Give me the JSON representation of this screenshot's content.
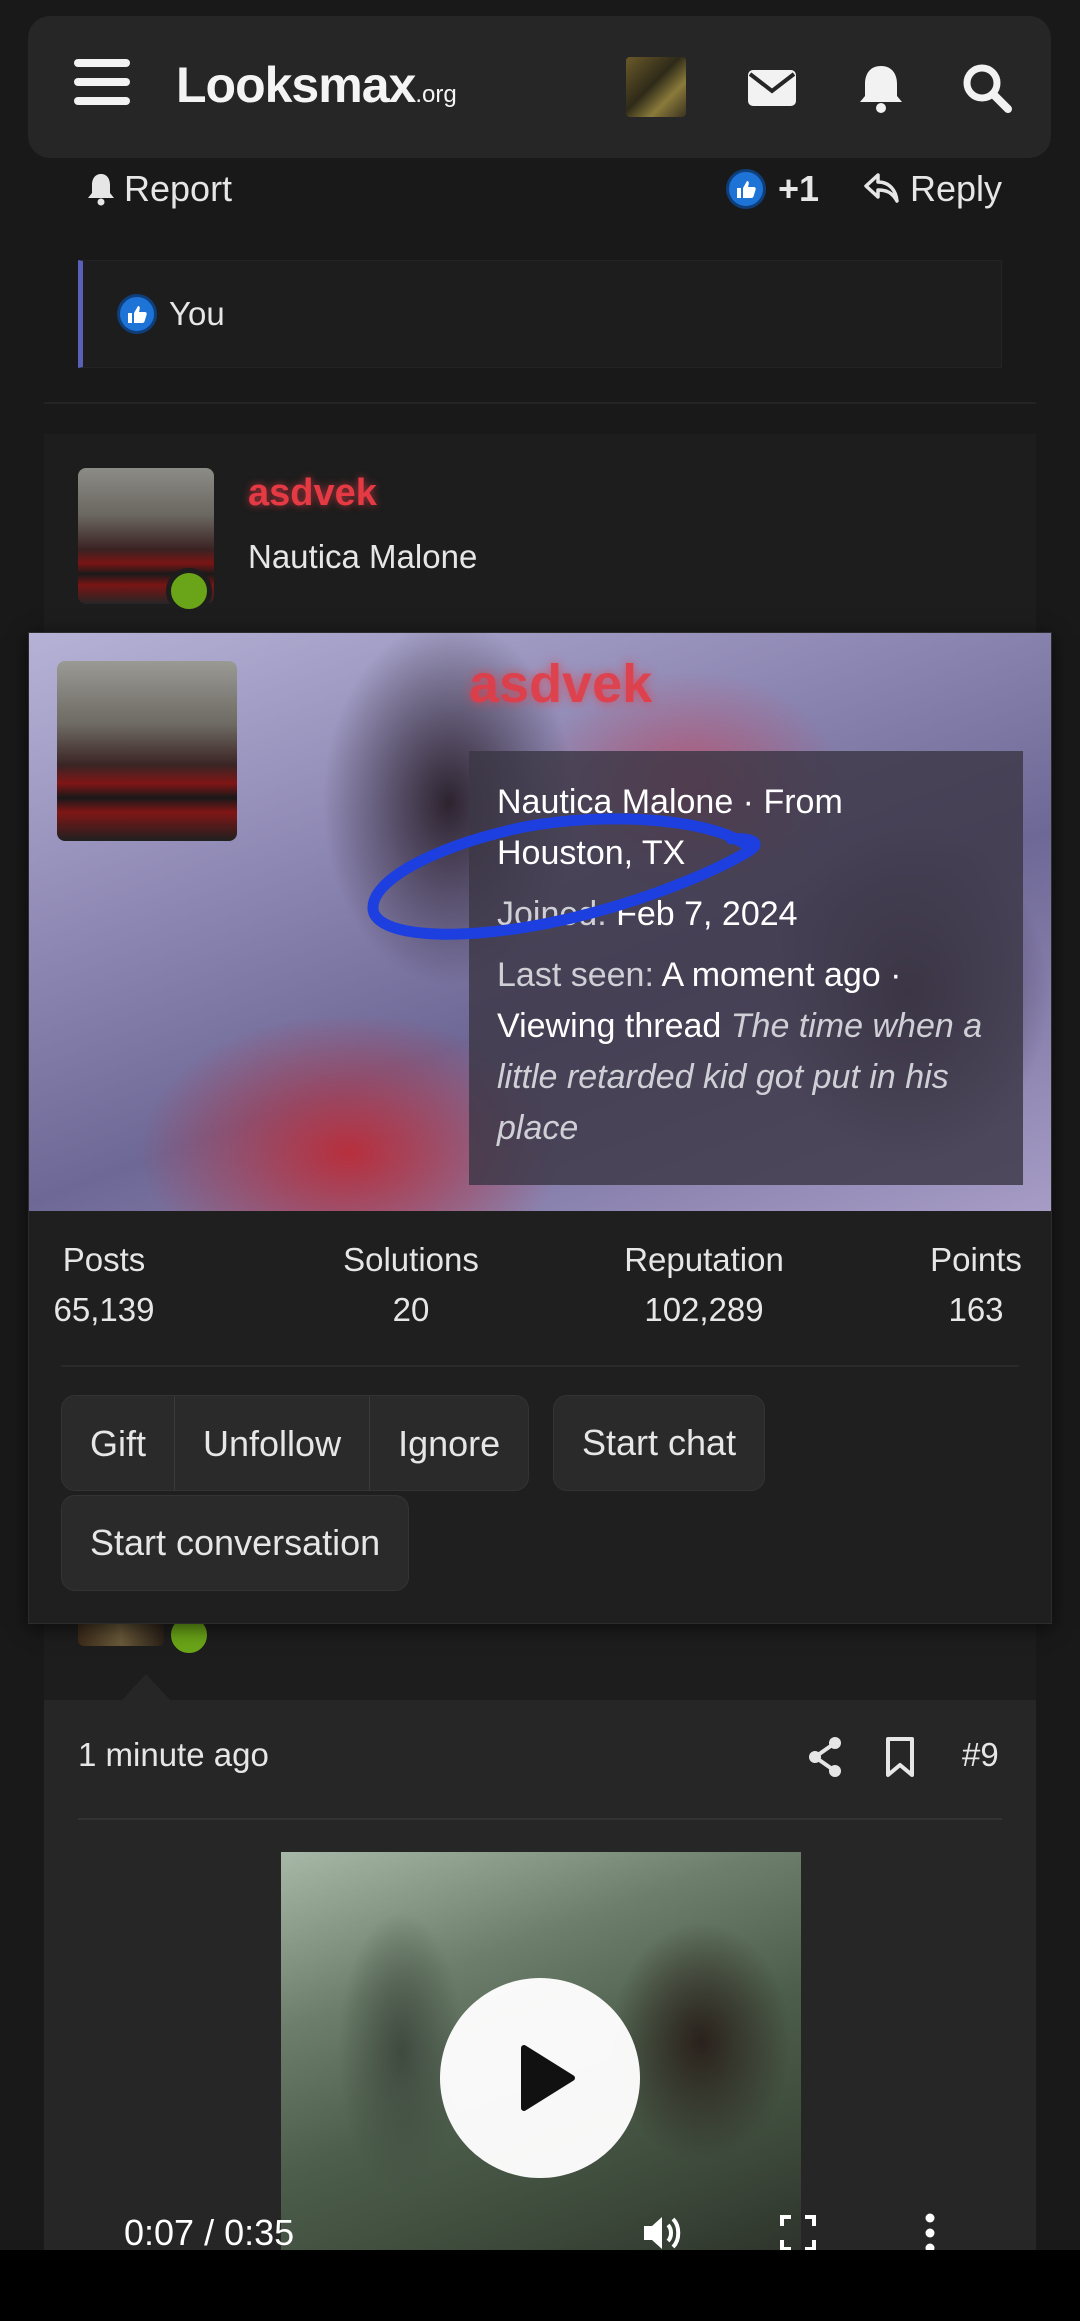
{
  "header": {
    "logo_main": "Looksmax",
    "logo_suffix": ".org",
    "icons": [
      "menu-icon",
      "envelope-icon",
      "bell-icon",
      "search-icon"
    ]
  },
  "prev_post": {
    "report_label": "Report",
    "like_count": "+1",
    "reply_label": "Reply",
    "reactions_text": "You"
  },
  "post": {
    "username": "asdvek",
    "user_title": "Nautica Malone",
    "time": "1 minute ago",
    "number": "#9"
  },
  "member_card": {
    "username": "asdvek",
    "title_line": "Nautica Malone · From",
    "location": "Houston, TX",
    "joined_label": "Joined:",
    "joined_value": "Feb 7, 2024",
    "last_seen_label": "Last seen:",
    "last_seen_value": "A moment ago ·",
    "activity": "Viewing thread",
    "thread_title": "The time when a little retarded kid got put in his place",
    "stats": [
      {
        "label": "Posts",
        "value": "65,139"
      },
      {
        "label": "Solutions",
        "value": "20"
      },
      {
        "label": "Reputation",
        "value": "102,289"
      },
      {
        "label": "Points",
        "value": "163"
      }
    ],
    "buttons": {
      "gift": "Gift",
      "unfollow": "Unfollow",
      "ignore": "Ignore",
      "start_chat": "Start chat",
      "start_conversation": "Start conversation"
    }
  },
  "video": {
    "time": "0:07 / 0:35"
  },
  "colors": {
    "accent_username": "#e53a44",
    "online": "#6aa418",
    "like_blue": "#1e73d6",
    "scribble": "#1d3fe0"
  }
}
